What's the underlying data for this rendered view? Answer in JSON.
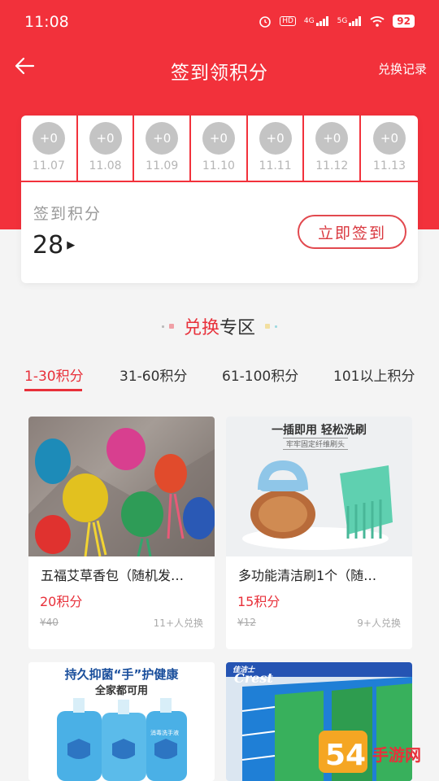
{
  "status_bar": {
    "time": "11:08",
    "hd_label": "HD",
    "net1": "4G",
    "net2": "5G",
    "battery": "92"
  },
  "header": {
    "title": "签到领积分",
    "right_link": "兑换记录"
  },
  "checkin": {
    "days": [
      {
        "points": "+0",
        "date": "11.07"
      },
      {
        "points": "+0",
        "date": "11.08"
      },
      {
        "points": "+0",
        "date": "11.09"
      },
      {
        "points": "+0",
        "date": "11.10"
      },
      {
        "points": "+0",
        "date": "11.11"
      },
      {
        "points": "+0",
        "date": "11.12"
      },
      {
        "points": "+0",
        "date": "11.13"
      }
    ],
    "points_label": "签到积分",
    "points_value": "28",
    "button_label": "立即签到"
  },
  "section": {
    "title_accent": "兑换",
    "title_rest": "专区"
  },
  "tabs": [
    "1-30积分",
    "31-60积分",
    "61-100积分",
    "101以上积分"
  ],
  "products": [
    {
      "name": "五福艾草香包（随机发…",
      "price": "20积分",
      "original": "¥40",
      "sold": "11+人兑换"
    },
    {
      "name": "多功能清洁刷1个（随…",
      "price": "15积分",
      "original": "¥12",
      "sold": "9+人兑换",
      "img_headline": "一插即用 轻松洗刷",
      "img_sub": "牢牢固定纤维刷头"
    },
    {
      "img_headline": "持久抑菌“手”护健康",
      "img_sub": "全家都可用",
      "bottle_label": "消毒洗手液"
    },
    {
      "img_brand": "Crest",
      "img_brand_cn": "佳洁士"
    }
  ],
  "watermark": {
    "text": "手游网",
    "num": "54"
  },
  "colors": {
    "primary": "#f2313b",
    "accent": "#e8303a"
  }
}
